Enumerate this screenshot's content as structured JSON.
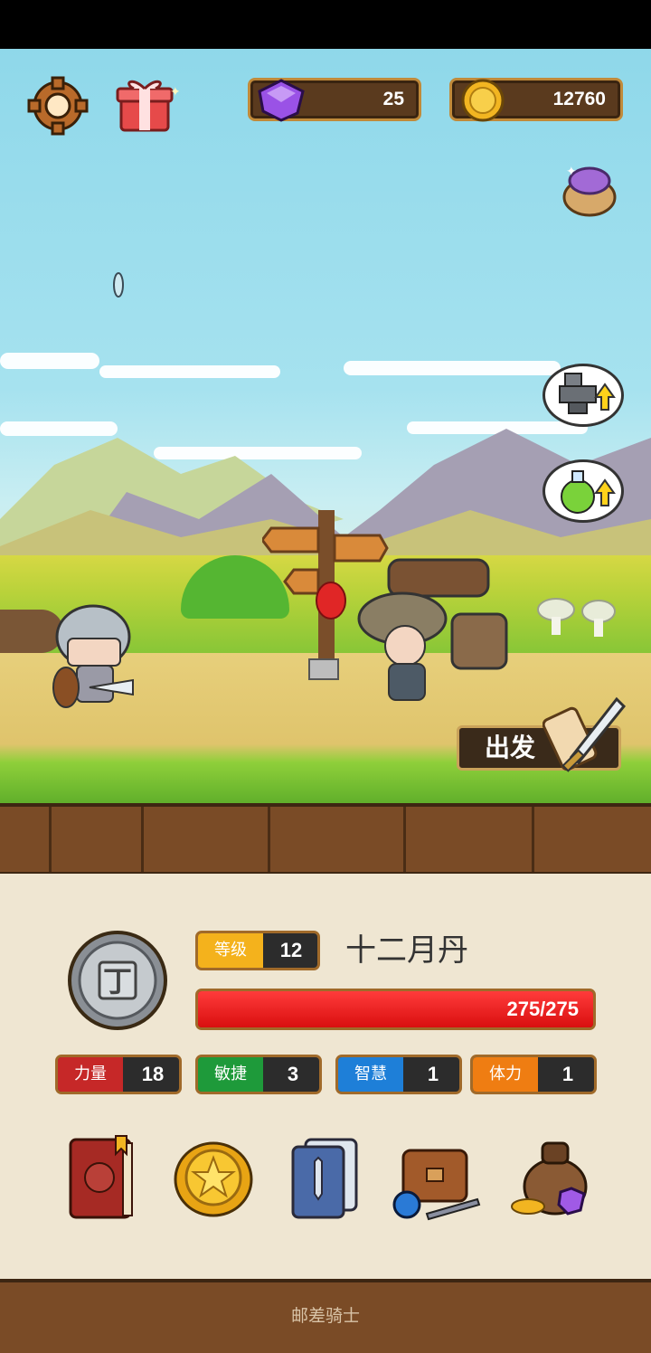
{
  "hud": {
    "gems": "25",
    "coins": "12760"
  },
  "actions": {
    "depart_label": "出发"
  },
  "player": {
    "level_label": "等级",
    "level": "12",
    "name": "十二月丹",
    "hp_text": "275/275",
    "hp_fraction": 1.0
  },
  "stats": [
    {
      "label": "力量",
      "value": "18",
      "color": "#c62828"
    },
    {
      "label": "敏捷",
      "value": "3",
      "color": "#1e9a3a"
    },
    {
      "label": "智慧",
      "value": "1",
      "color": "#1e7fd8"
    },
    {
      "label": "体力",
      "value": "1",
      "color": "#ef7d12"
    }
  ],
  "footer": {
    "title": "邮差骑士"
  },
  "colors": {
    "sky": "#a6e2ef",
    "panel": "#efe6d2",
    "dirt": "#7a4b26",
    "hp": "#e11414",
    "level_tag": "#f4b21c"
  }
}
